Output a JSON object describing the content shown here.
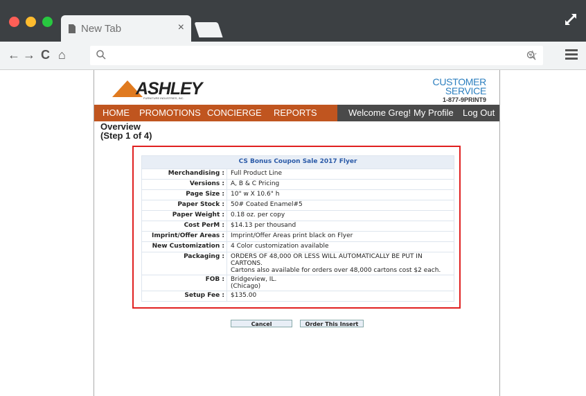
{
  "browser": {
    "tab_title": "New Tab",
    "tab_close": "×",
    "nav": {
      "back": "←",
      "forward": "→",
      "reload": "C",
      "home": "⌂"
    },
    "star": "☆"
  },
  "site": {
    "brand": "ASHLEY",
    "brand_sub": "FURNITURE INDUSTRIES, INC.",
    "customer_service": {
      "line1": "CUSTOMER",
      "line2": "SERVICE",
      "phone": "1-877-9PRINT9"
    },
    "nav": {
      "home": "HOME",
      "promotions": "PROMOTIONS",
      "concierge": "CONCIERGE",
      "reports": "REPORTS",
      "welcome": "Welcome Greg!",
      "profile": "My Profile",
      "logout": "Log Out"
    },
    "colors": {
      "nav_orange": "#c0551f",
      "nav_dark": "#4a4a4a",
      "highlight": "#e02020",
      "accent_blue": "#2c7fbf"
    }
  },
  "overview": {
    "title": "Overview",
    "step": "(Step 1 of 4)"
  },
  "table": {
    "title": "CS Bonus Coupon Sale 2017 Flyer",
    "rows": [
      {
        "label": "Merchandising :",
        "value": "Full Product Line"
      },
      {
        "label": "Versions :",
        "value": "A, B & C Pricing"
      },
      {
        "label": "Page Size :",
        "value": "10\" w X 10.6\" h"
      },
      {
        "label": "Paper Stock :",
        "value": "50# Coated Enamel#5"
      },
      {
        "label": "Paper Weight :",
        "value": "0.18 oz. per copy"
      },
      {
        "label": "Cost PerM :",
        "value": "$14.13 per thousand"
      },
      {
        "label": "Imprint/Offer Areas :",
        "value": "Imprint/Offer Areas print black on Flyer"
      },
      {
        "label": "New Customization :",
        "value": "4 Color customization available"
      },
      {
        "label": "Packaging :",
        "value": "ORDERS OF 48,000 OR LESS WILL AUTOMATICALLY BE PUT IN CARTONS.",
        "value2": "Cartons also available for orders over 48,000 cartons cost $2 each."
      },
      {
        "label": "FOB :",
        "value": "Bridgeview, IL.",
        "value2": "(Chicago)"
      },
      {
        "label": "Setup Fee :",
        "value": "$135.00"
      }
    ]
  },
  "buttons": {
    "cancel": "Cancel",
    "order": "Order This Insert"
  }
}
